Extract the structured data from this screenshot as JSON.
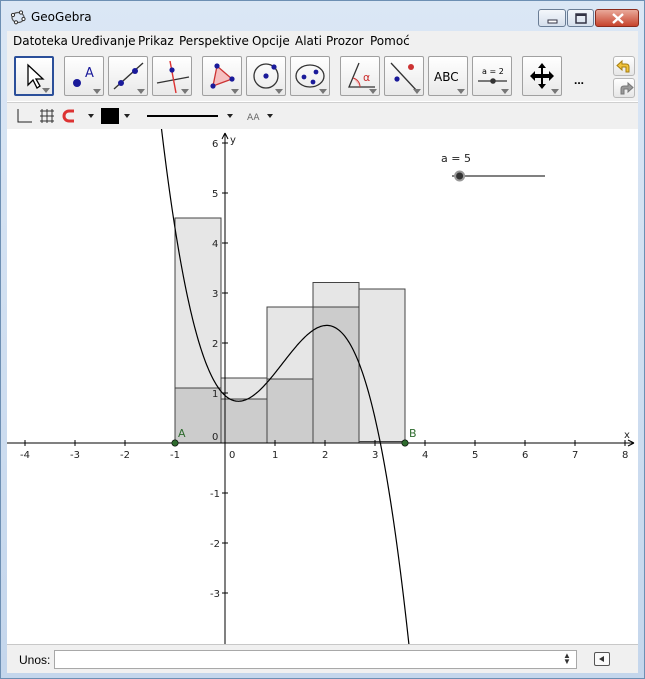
{
  "window": {
    "title": "GeoGebra",
    "accent": "#2b4f9a"
  },
  "menu": {
    "items": [
      "Datoteka",
      "Uređivanje",
      "Prikaz",
      "Perspektive",
      "Opcije",
      "Alati",
      "Prozor",
      "Pomoć"
    ]
  },
  "toolbar": {
    "tools": [
      {
        "name": "move-tool",
        "icon": "arrow-cursor-icon"
      },
      {
        "name": "point-tool",
        "icon": "point-icon",
        "text": "A"
      },
      {
        "name": "line-tool",
        "icon": "line-through-points-icon"
      },
      {
        "name": "perpendicular-tool",
        "icon": "perpendicular-line-icon"
      },
      {
        "name": "polygon-tool",
        "icon": "polygon-icon"
      },
      {
        "name": "circle-tool",
        "icon": "circle-center-point-icon"
      },
      {
        "name": "ellipse-tool",
        "icon": "ellipse-icon"
      },
      {
        "name": "angle-tool",
        "icon": "angle-icon",
        "text": "α"
      },
      {
        "name": "reflect-tool",
        "icon": "reflect-line-icon"
      },
      {
        "name": "text-tool",
        "icon": "text-icon",
        "text": "ABC"
      },
      {
        "name": "slider-tool",
        "icon": "slider-icon",
        "text": "a = 2"
      },
      {
        "name": "move-graphics-tool",
        "icon": "move-arrows-icon"
      }
    ],
    "more": "..."
  },
  "stylebar": {
    "line_color": "#000000",
    "label_icon_text": "AA"
  },
  "graphics": {
    "x_ticks": [
      "-4",
      "-3",
      "-2",
      "-1",
      "0",
      "1",
      "2",
      "3",
      "4",
      "5",
      "6",
      "7",
      "8"
    ],
    "y_ticks": [
      "6",
      "5",
      "4",
      "3",
      "2",
      "1",
      "-1",
      "-2",
      "-3"
    ],
    "origin_y_label": "0",
    "x_axis_label": "x",
    "y_axis_label": "y",
    "slider": {
      "label": "a = 5",
      "value": 5,
      "min": 1,
      "max": 50
    },
    "point_A": {
      "label": "A",
      "x": -1,
      "y": 0
    },
    "point_B": {
      "label": "B",
      "x": 3.6,
      "y": 0
    },
    "point_color": "#2e6b2e",
    "curve_color": "#000000",
    "lower_fill": "#cccccc",
    "upper_fill": "#e6e6e6",
    "upper_sums": [
      4.5,
      1.3,
      2.72,
      3.21,
      3.08
    ],
    "lower_sums": [
      1.1,
      0.88,
      1.28,
      2.72,
      0.03
    ]
  },
  "inputbar": {
    "label": "Unos:",
    "value": ""
  }
}
